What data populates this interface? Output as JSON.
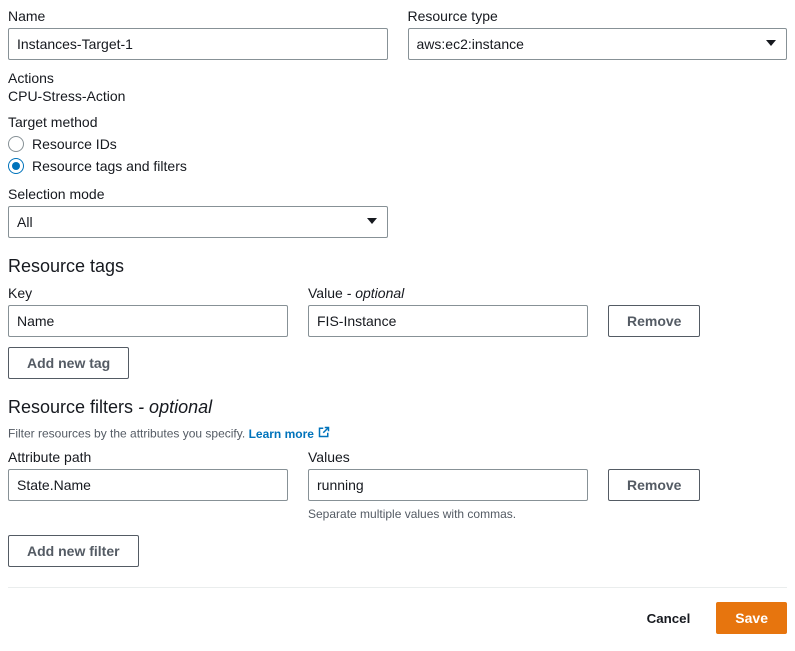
{
  "top": {
    "name_label": "Name",
    "name_value": "Instances-Target-1",
    "resource_type_label": "Resource type",
    "resource_type_value": "aws:ec2:instance"
  },
  "actions": {
    "label": "Actions",
    "value": "CPU-Stress-Action"
  },
  "target_method": {
    "label": "Target method",
    "options": {
      "resource_ids": "Resource IDs",
      "tags_filters": "Resource tags and filters"
    },
    "selected": "tags_filters"
  },
  "selection_mode": {
    "label": "Selection mode",
    "value": "All"
  },
  "resource_tags": {
    "heading": "Resource tags",
    "key_label": "Key",
    "value_label": "Value",
    "value_optional": "- optional",
    "rows": [
      {
        "key": "Name",
        "value": "FIS-Instance"
      }
    ],
    "remove_label": "Remove",
    "add_label": "Add new tag"
  },
  "resource_filters": {
    "heading": "Resource filters",
    "heading_optional": "- optional",
    "description": "Filter resources by the attributes you specify.",
    "learn_more": "Learn more",
    "attribute_label": "Attribute path",
    "values_label": "Values",
    "help": "Separate multiple values with commas.",
    "rows": [
      {
        "path": "State.Name",
        "values": "running"
      }
    ],
    "remove_label": "Remove",
    "add_label": "Add new filter"
  },
  "footer": {
    "cancel": "Cancel",
    "save": "Save"
  }
}
